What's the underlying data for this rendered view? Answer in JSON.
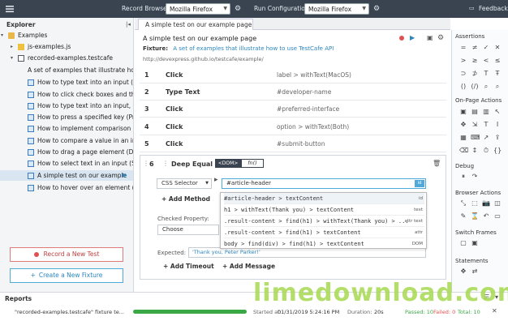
{
  "topbar": {
    "record_browser_label": "Record Browser:",
    "record_browser_value": "Mozilla Firefox",
    "run_config_label": "Run Configuration:",
    "run_config_value": "Mozilla Firefox",
    "feedback_label": "Feedback"
  },
  "explorer": {
    "title": "Explorer",
    "items": [
      {
        "label": "Examples"
      },
      {
        "label": "js-examples.js"
      },
      {
        "label": "recorded-examples.testcafe"
      },
      {
        "label": "A set of examples that illustrate how"
      },
      {
        "label": "How to type text into an input (Type"
      },
      {
        "label": "How to click check boxes and then"
      },
      {
        "label": "How to type text into an input, clic"
      },
      {
        "label": "How to press a specified key (Pres"
      },
      {
        "label": "How to implement comparison (O"
      },
      {
        "label": "How to compare a value in an inpu"
      },
      {
        "label": "How to drag a page element (Drag"
      },
      {
        "label": "How to select text in an input (Sele"
      },
      {
        "label": "A simple test on our example"
      },
      {
        "label": "How to hover over an element (t.h"
      }
    ],
    "record_button": "Record a New Test",
    "fixture_button": "Create a New Fixture"
  },
  "editor": {
    "tab_label": "A simple test on our example page",
    "test_title": "A simple test on our example page",
    "fixture_label": "Fixture:",
    "fixture_value": "A set of examples that illustrate how to use TestCafe API",
    "url": "http://devexpress.github.io/testcafe/example/",
    "steps": [
      {
        "num": "1",
        "action": "Click",
        "selector": "label > withText(MacOS)"
      },
      {
        "num": "2",
        "action": "Type Text",
        "selector": "#developer-name"
      },
      {
        "num": "3",
        "action": "Click",
        "selector": "#preferred-interface"
      },
      {
        "num": "4",
        "action": "Click",
        "selector": "option > withText(Both)"
      },
      {
        "num": "5",
        "action": "Click",
        "selector": "#submit-button"
      }
    ],
    "active_step": {
      "num": "6",
      "action": "Deep Equal",
      "dom_tag": "<DOM>",
      "fn_tag": "fn()",
      "selector_type": "CSS Selector",
      "selector_value": "#article-header",
      "id_badge": "id",
      "add_method": "+ Add Method",
      "checked_property_label": "Checked Property:",
      "choose_label": "Choose",
      "expected_label": "Expected:",
      "expected_value": "'Thank you, Peter Parker!'",
      "add_timeout": "+ Add Timeout",
      "add_message": "+ Add Message"
    },
    "suggestions": [
      {
        "text": "#article-header > textContent",
        "tag": "id"
      },
      {
        "text": "h1 > withText(Thank you) > textContent",
        "tag": "text"
      },
      {
        "text": ".result-content > find(h1) > withText(Thank you) > ...",
        "tag": "attr text"
      },
      {
        "text": ".result-content > find(h1) > textContent",
        "tag": "attr"
      },
      {
        "text": "body > find(div) > find(h1) > textContent",
        "tag": "DOM"
      }
    ]
  },
  "right_panel": {
    "assertions": "Assertions",
    "on_page_actions": "On-Page Actions",
    "debug": "Debug",
    "browser_actions": "Browser Actions",
    "switch_frames": "Switch Frames",
    "statements": "Statements"
  },
  "reports": {
    "title": "Reports",
    "run_label": "\"recorded-examples.testcafe\" fixture te...",
    "started_label": "Started at:",
    "started_value": "01/31/2019 5:24:16 PM",
    "duration_label": "Duration:",
    "duration_value": "20s",
    "passed": "Passed: 10",
    "failed": "Failed: 0",
    "total": "Total: 10",
    "progress": 1.0
  },
  "watermark": "limedownload.com",
  "colors": {
    "accent": "#2a86bf",
    "topbar": "#3a4450",
    "record": "#e05050",
    "passed": "#3aa845"
  }
}
